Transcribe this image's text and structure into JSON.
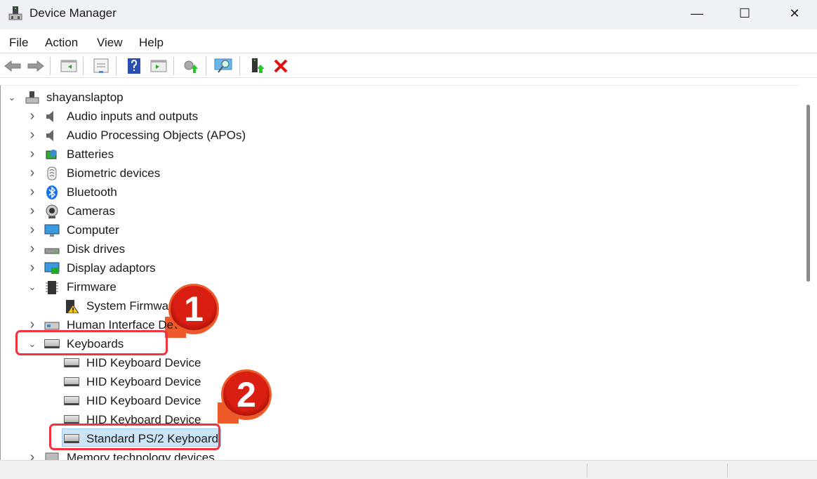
{
  "window": {
    "title": "Device Manager",
    "minimize": "—",
    "maximize": "☐",
    "close": "✕"
  },
  "menu": [
    "File",
    "Action",
    "View",
    "Help"
  ],
  "toolbar": [
    "back-icon",
    "forward-icon",
    "show-hide-console-tree-icon",
    "properties-icon",
    "help-icon",
    "action-pane-icon",
    "update-driver-icon",
    "scan-hardware-icon",
    "enable-device-icon",
    "uninstall-icon"
  ],
  "tree": {
    "root": "shayanslaptop",
    "items": [
      {
        "label": "Audio inputs and outputs",
        "level": 1,
        "state": "collapsed",
        "icon": "speaker-icon"
      },
      {
        "label": "Audio Processing Objects (APOs)",
        "level": 1,
        "state": "collapsed",
        "icon": "speaker-icon"
      },
      {
        "label": "Batteries",
        "level": 1,
        "state": "collapsed",
        "icon": "battery-icon"
      },
      {
        "label": "Biometric devices",
        "level": 1,
        "state": "collapsed",
        "icon": "fingerprint-icon"
      },
      {
        "label": "Bluetooth",
        "level": 1,
        "state": "collapsed",
        "icon": "bluetooth-icon"
      },
      {
        "label": "Cameras",
        "level": 1,
        "state": "collapsed",
        "icon": "camera-icon"
      },
      {
        "label": "Computer",
        "level": 1,
        "state": "collapsed",
        "icon": "monitor-icon"
      },
      {
        "label": "Disk drives",
        "level": 1,
        "state": "collapsed",
        "icon": "disk-icon"
      },
      {
        "label": "Display adaptors",
        "level": 1,
        "state": "collapsed",
        "icon": "display-adapter-icon"
      },
      {
        "label": "Firmware",
        "level": 1,
        "state": "expanded",
        "icon": "chip-icon"
      },
      {
        "label": "System Firmware",
        "level": 2,
        "state": "leaf",
        "icon": "chip-warning-icon"
      },
      {
        "label": "Human Interface Devices",
        "level": 1,
        "state": "collapsed",
        "icon": "hid-icon"
      },
      {
        "label": "Keyboards",
        "level": 1,
        "state": "expanded",
        "icon": "keyboard-icon"
      },
      {
        "label": "HID Keyboard Device",
        "level": 2,
        "state": "leaf",
        "icon": "keyboard-icon"
      },
      {
        "label": "HID Keyboard Device",
        "level": 2,
        "state": "leaf",
        "icon": "keyboard-icon"
      },
      {
        "label": "HID Keyboard Device",
        "level": 2,
        "state": "leaf",
        "icon": "keyboard-icon"
      },
      {
        "label": "HID Keyboard Device",
        "level": 2,
        "state": "leaf",
        "icon": "keyboard-icon"
      },
      {
        "label": "Standard PS/2 Keyboard",
        "level": 2,
        "state": "selected",
        "icon": "keyboard-icon"
      },
      {
        "label": "Memory technology devices",
        "level": 1,
        "state": "collapsed",
        "icon": "memory-icon"
      }
    ]
  },
  "annotations": {
    "step1": "1",
    "step2": "2"
  },
  "colors": {
    "highlight": "#f2323c",
    "badge": "#d91e12",
    "selection": "#cce4f7"
  }
}
